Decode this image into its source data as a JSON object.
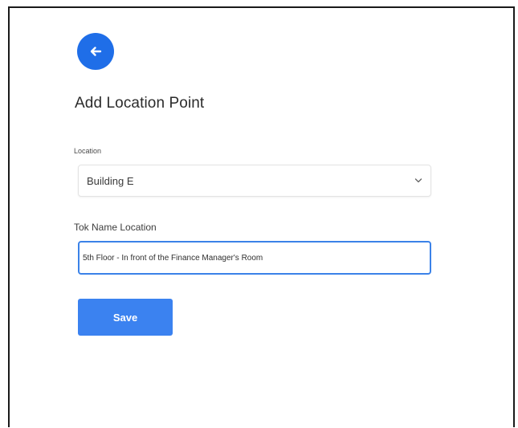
{
  "header": {
    "back_icon": "arrow-left-icon",
    "title": "Add Location Point"
  },
  "form": {
    "location": {
      "label": "Location",
      "selected": "Building E",
      "icon": "chevron-down-icon"
    },
    "tok_name": {
      "label": "Tok Name Location",
      "value": "5th Floor - In front of the Finance Manager's Room"
    },
    "save_label": "Save"
  },
  "colors": {
    "accent": "#1f6ee8",
    "button": "#3b82f0",
    "focus_border": "#3b82e8"
  }
}
